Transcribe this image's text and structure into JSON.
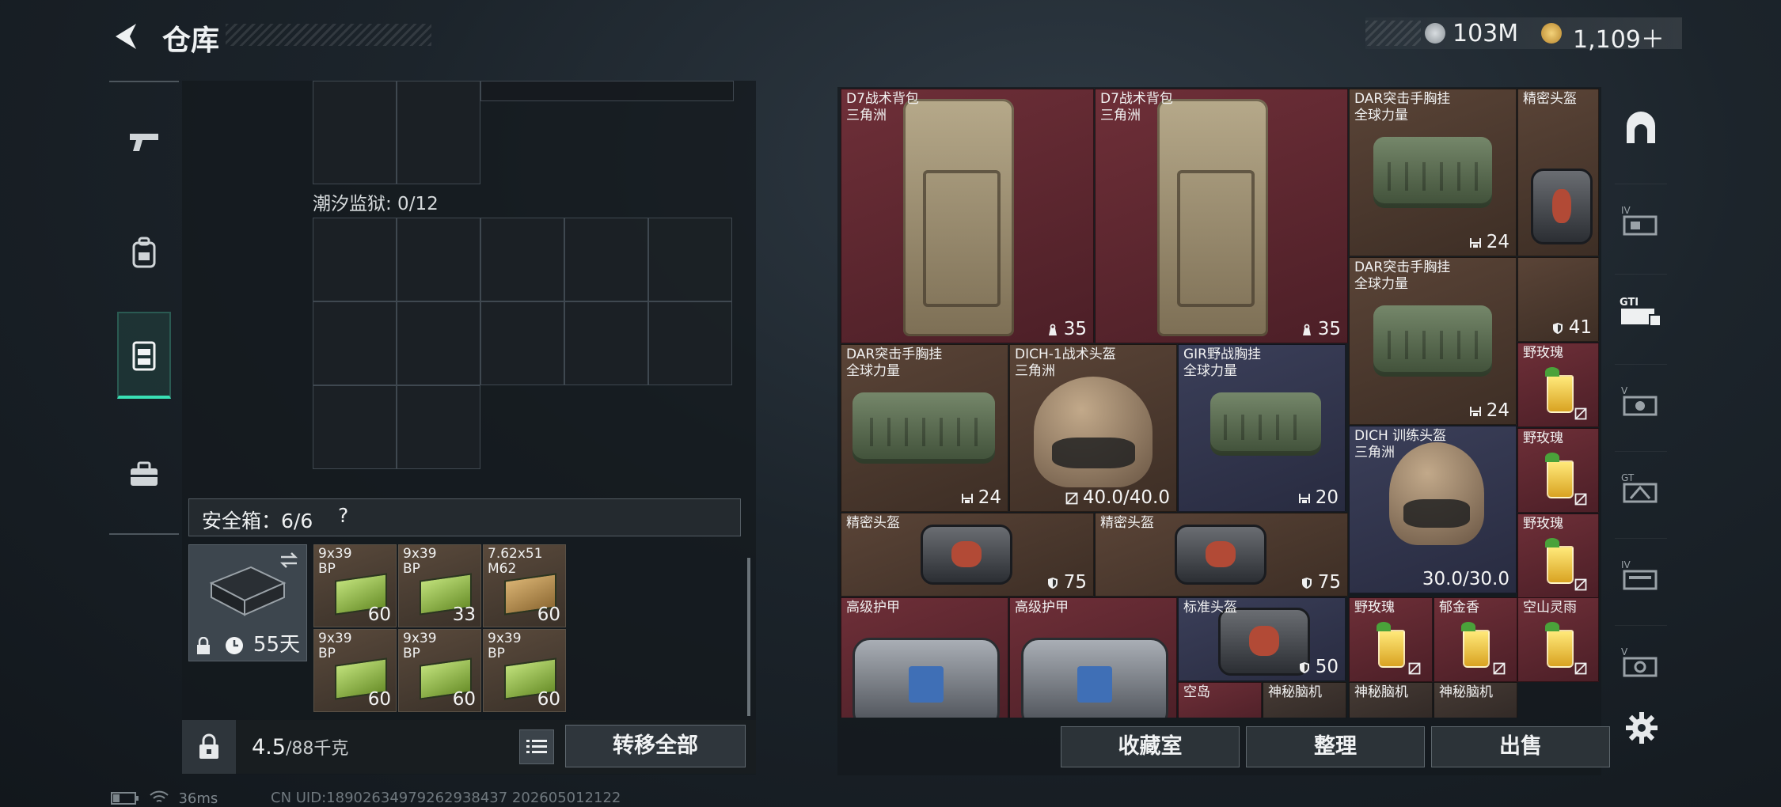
{
  "header": {
    "title": "仓库",
    "currency1": "103M",
    "currency2": "1,109＋"
  },
  "left_nav": [
    "pistol-icon",
    "backpack-icon",
    "chest-rig-icon",
    "toolbox-icon"
  ],
  "left_panel": {
    "tide_prison": "潮汐监狱: 0/12",
    "safe_label": "安全箱：6/6",
    "safe_help": "?",
    "safe_days": "55天",
    "ammo": [
      {
        "name": "9x39\nBP",
        "count": "60"
      },
      {
        "name": "9x39\nBP",
        "count": "33"
      },
      {
        "name": "7.62x51\nM62",
        "count": "60"
      },
      {
        "name": "9x39\nBP",
        "count": "60"
      },
      {
        "name": "9x39\nBP",
        "count": "60"
      },
      {
        "name": "9x39\nBP",
        "count": "60"
      }
    ],
    "weight_value": "4.5",
    "weight_suffix": "/88千克",
    "transfer_all": "转移全部"
  },
  "items": [
    {
      "name": "D7战术背包\n三角洲",
      "value": "35",
      "color": "red"
    },
    {
      "name": "D7战术背包\n三角洲",
      "value": "35",
      "color": "red"
    },
    {
      "name": "DAR突击手胸挂\n全球力量",
      "value": "24",
      "color": "brown"
    },
    {
      "name": "精密头盔",
      "value": "",
      "color": "brown"
    },
    {
      "name": "DAR突击手胸挂\n全球力量",
      "value": "24",
      "color": "brown"
    },
    {
      "name": "",
      "value": "41",
      "color": "brown"
    },
    {
      "name": "DAR突击手胸挂\n全球力量",
      "value": "24",
      "color": "brown"
    },
    {
      "name": "DICH-1战术头盔\n三角洲",
      "value": "40.0/40.0",
      "color": "brown"
    },
    {
      "name": "GIR野战胸挂\n全球力量",
      "value": "20",
      "color": "blue"
    },
    {
      "name": "野玫瑰",
      "value": "",
      "color": "red"
    },
    {
      "name": "DICH 训练头盔\n三角洲",
      "value": "30.0/30.0",
      "color": "blue"
    },
    {
      "name": "野玫瑰",
      "value": "",
      "color": "red"
    },
    {
      "name": "精密头盔",
      "value": "75",
      "color": "brown"
    },
    {
      "name": "精密头盔",
      "value": "75",
      "color": "brown"
    },
    {
      "name": "野玫瑰",
      "value": "",
      "color": "red"
    },
    {
      "name": "高级护甲",
      "value": "",
      "color": "red"
    },
    {
      "name": "高级护甲",
      "value": "",
      "color": "red"
    },
    {
      "name": "标准头盔",
      "value": "50",
      "color": "blue"
    },
    {
      "name": "野玫瑰",
      "value": "",
      "color": "red"
    },
    {
      "name": "郁金香",
      "value": "",
      "color": "red"
    },
    {
      "name": "空山灵雨",
      "value": "",
      "color": "red"
    },
    {
      "name": "空岛",
      "value": "",
      "color": "red"
    },
    {
      "name": "神秘脑机",
      "value": "",
      "color": "dk"
    },
    {
      "name": "神秘脑机",
      "value": "",
      "color": "dk"
    },
    {
      "name": "神秘脑机",
      "value": "",
      "color": "dk"
    }
  ],
  "bottom_buttons": {
    "collection": "收藏室",
    "organize": "整理",
    "sell": "出售"
  },
  "status": {
    "ping": "36ms",
    "uid": "CN UID:18902634979262938437 202605012122"
  },
  "colors": {
    "accent": "#39e0b5",
    "red_tier": "#6e2f38",
    "brown_tier": "#5a4437",
    "blue_tier": "#3b3f59"
  }
}
